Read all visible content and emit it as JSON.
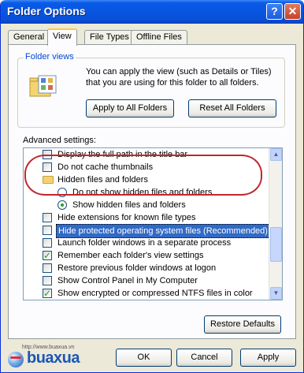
{
  "window": {
    "title": "Folder Options",
    "help_glyph": "?",
    "close_glyph": "✕"
  },
  "tabs": [
    {
      "label": "General"
    },
    {
      "label": "View"
    },
    {
      "label": "File Types"
    },
    {
      "label": "Offline Files"
    }
  ],
  "active_tab": "View",
  "folder_views": {
    "title": "Folder views",
    "description": "You can apply the view (such as Details or Tiles) that you are using for this folder to all folders.",
    "apply_button": "Apply to All Folders",
    "reset_button": "Reset All Folders"
  },
  "advanced": {
    "label": "Advanced settings:",
    "items": [
      {
        "kind": "checkbox",
        "checked": false,
        "label": "Display the full path in the title bar"
      },
      {
        "kind": "checkbox",
        "checked": false,
        "label": "Do not cache thumbnails"
      },
      {
        "kind": "folder",
        "label": "Hidden files and folders"
      },
      {
        "kind": "radio",
        "checked": false,
        "label": "Do not show hidden files and folders"
      },
      {
        "kind": "radio",
        "checked": true,
        "label": "Show hidden files and folders"
      },
      {
        "kind": "checkbox",
        "checked": false,
        "label": "Hide extensions for known file types"
      },
      {
        "kind": "checkbox",
        "checked": false,
        "selected": true,
        "label": "Hide protected operating system files (Recommended)"
      },
      {
        "kind": "checkbox",
        "checked": false,
        "label": "Launch folder windows in a separate process"
      },
      {
        "kind": "checkbox",
        "checked": true,
        "label": "Remember each folder's view settings"
      },
      {
        "kind": "checkbox",
        "checked": false,
        "label": "Restore previous folder windows at logon"
      },
      {
        "kind": "checkbox",
        "checked": false,
        "label": "Show Control Panel in My Computer"
      },
      {
        "kind": "checkbox",
        "checked": true,
        "label": "Show encrypted or compressed NTFS files in color"
      }
    ],
    "restore_button": "Restore Defaults"
  },
  "footer": {
    "ok": "OK",
    "cancel": "Cancel",
    "apply": "Apply"
  },
  "watermark": {
    "url": "http://www.buaxua.vn",
    "brand": "buaxua"
  },
  "colors": {
    "accent": "#0a5ae8",
    "highlight": "#316ac5",
    "annotation": "#c0282d"
  }
}
